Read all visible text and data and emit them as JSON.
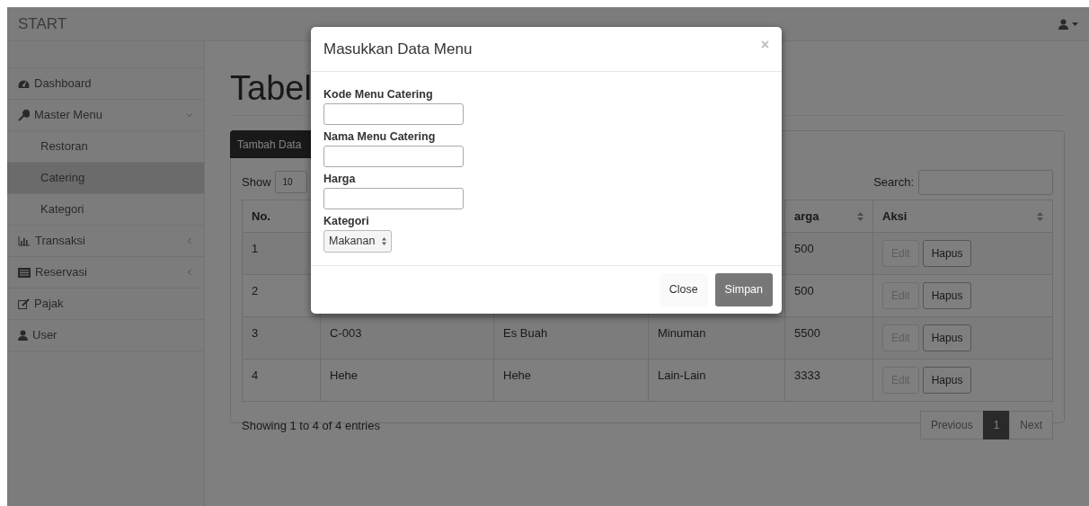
{
  "navbar": {
    "brand": "START",
    "user_menu": {
      "caret": true
    }
  },
  "sidebar": {
    "items": [
      {
        "label": "Dashboard",
        "selected": false
      },
      {
        "label": "Master Menu",
        "selected": false,
        "expanded": true,
        "children": [
          {
            "label": "Restoran",
            "selected": false
          },
          {
            "label": "Catering",
            "selected": true
          },
          {
            "label": "Kategori",
            "selected": false
          }
        ]
      },
      {
        "label": "Transaksi",
        "selected": false,
        "expanded": false
      },
      {
        "label": "Reservasi",
        "selected": false,
        "expanded": false
      },
      {
        "label": "Pajak",
        "selected": false
      },
      {
        "label": "User",
        "selected": false
      }
    ]
  },
  "page": {
    "heading": "Tabel"
  },
  "panel": {
    "add_button": "Tambah Data",
    "length": {
      "label": "Show",
      "value": "10"
    },
    "search": {
      "label": "Search:"
    },
    "table": {
      "columns": {
        "column_1": {
          "label": "No."
        },
        "column_5": {
          "label": "arga",
          "sortable": true
        },
        "column_6": {
          "label": "Aksi",
          "sortable": true
        }
      },
      "rows": [
        {
          "column_1": "1",
          "column_5": "500",
          "actions": [
            {
              "label": "Edit",
              "disabled": true
            },
            {
              "label": "Hapus",
              "disabled": false
            }
          ]
        },
        {
          "column_1": "2",
          "column_5": "500",
          "actions": [
            {
              "label": "Edit",
              "disabled": true
            },
            {
              "label": "Hapus",
              "disabled": false
            }
          ]
        },
        {
          "column_1": "3",
          "column_2": "C-003",
          "column_3": "Es Buah",
          "column_4": "Minuman",
          "column_5": "5500",
          "actions": [
            {
              "label": "Edit",
              "disabled": true
            },
            {
              "label": "Hapus",
              "disabled": false
            }
          ]
        },
        {
          "column_1": "4",
          "column_2": "Hehe",
          "column_3": "Hehe",
          "column_4": "Lain-Lain",
          "column_5": "3333",
          "actions": [
            {
              "label": "Edit",
              "disabled": true
            },
            {
              "label": "Hapus",
              "disabled": false
            }
          ]
        }
      ]
    },
    "info": "Showing 1 to 4 of 4 entries",
    "pagination": [
      {
        "label": "Previous",
        "selected": false
      },
      {
        "label": "1",
        "selected": true
      },
      {
        "label": "Next",
        "selected": false
      }
    ]
  },
  "modal": {
    "title": "Masukkan Data Menu",
    "close": "×",
    "fields": [
      {
        "label": "Kode Menu Catering",
        "kind": "text"
      },
      {
        "label": "Nama Menu Catering",
        "kind": "text"
      },
      {
        "label": "Harga",
        "kind": "text"
      },
      {
        "label": "Kategori",
        "kind": "select",
        "value": "Makanan"
      }
    ],
    "buttons": [
      {
        "label": "Close",
        "kind": "default"
      },
      {
        "label": "Simpan",
        "kind": "primary"
      }
    ]
  }
}
